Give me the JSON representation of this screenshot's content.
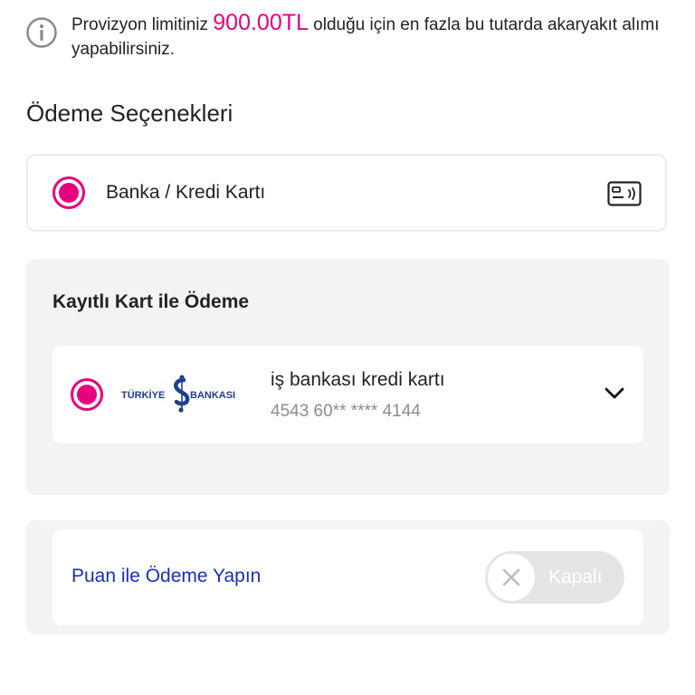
{
  "info": {
    "prefix": "Provizyon limitiniz ",
    "amount": "900.00TL",
    "suffix": " olduğu için en fazla bu tutarda akaryakıt alımı yapabilirsiniz."
  },
  "payment_options": {
    "title": "Ödeme Seçenekleri",
    "bank_card_label": "Banka / Kredi Kartı"
  },
  "saved_card": {
    "title": "Kayıtlı Kart ile Ödeme",
    "bank_logo": {
      "left_text": "TÜRKİYE",
      "right_text": "BANKASI"
    },
    "card_name": "iş bankası kredi kartı",
    "card_number": "4543 60** **** 4144"
  },
  "points": {
    "label": "Puan ile Ödeme Yapın",
    "toggle_label": "Kapalı",
    "enabled": false
  },
  "colors": {
    "accent": "#e6007e",
    "link": "#1a2fc0",
    "panel_bg": "#f3f3f5",
    "bank_blue": "#1f3e8f"
  }
}
